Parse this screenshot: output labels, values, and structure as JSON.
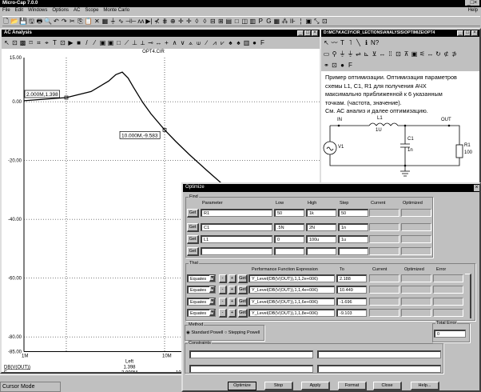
{
  "app": {
    "title": "Micro-Cap 7.0.0",
    "menu": [
      "File",
      "Edit",
      "Windows",
      "Options",
      "AC",
      "Scope",
      "Monte Carlo"
    ],
    "help": "Help",
    "toolbar": [
      "🗋",
      "📂",
      "💾",
      "🖫",
      "🖶",
      "🔍",
      "↶",
      "↷",
      "✂",
      "⎘",
      "📋",
      "✕",
      "▦",
      "⏚",
      "∿",
      "⊣⊢",
      "ᴧᴧ",
      "▶|",
      "⊀",
      "⋕",
      "⊕",
      "✛",
      "✛",
      "◊",
      "◊",
      "⊟",
      "⊞",
      "▤",
      "□",
      "◫",
      "▥",
      "P",
      "G",
      "▦",
      "⁂",
      "⊪",
      "¦",
      "▣",
      "⤡",
      "⊡"
    ],
    "window_controls": [
      "_",
      "□",
      "×"
    ]
  },
  "ac_window": {
    "title": "AC Analysis",
    "toolbar": [
      "↖",
      "⊡",
      "▩",
      "⌑",
      "⌗",
      "⌖",
      "T",
      "⊡",
      "▶",
      "■",
      "/",
      "⁄",
      "▣",
      "▣",
      "□",
      "⟋",
      "⊥",
      "⟂",
      "⊸",
      "↔",
      "+",
      "∧",
      "∨",
      "⟑",
      "⟒",
      "∕",
      "⩘",
      "⩗",
      "♠",
      "♠",
      "▥",
      "●",
      "F"
    ],
    "status": "Cursor Mode"
  },
  "chart_data": {
    "type": "line",
    "title": "OPT4.CIR",
    "xscale": "log",
    "xlim": [
      1,
      100
    ],
    "ylim": [
      -85,
      15
    ],
    "x_ticks": [
      {
        "v": 1,
        "label": "1M"
      },
      {
        "v": 10,
        "label": "10M"
      }
    ],
    "y_ticks": [
      {
        "v": 15,
        "label": "15.00"
      },
      {
        "v": 0,
        "label": "0.00"
      },
      {
        "v": -20,
        "label": "-20.00"
      },
      {
        "v": -40,
        "label": "-40.00"
      },
      {
        "v": -60,
        "label": "-60.00"
      },
      {
        "v": -80,
        "label": "-80.00"
      },
      {
        "v": -85,
        "label": "-85.00"
      }
    ],
    "grid": true,
    "line_color": "#000000",
    "x": [
      1,
      2,
      3,
      4,
      4.5,
      5,
      5.5,
      6,
      7,
      8,
      10,
      12,
      15,
      20,
      30,
      40
    ],
    "y": [
      0.33,
      1.398,
      3.46,
      7.01,
      9.2,
      10.05,
      8.04,
      4.96,
      -0.28,
      -4.12,
      -9.583,
      -13.5,
      -18.0,
      -23.4,
      -30.8,
      -35.9
    ],
    "cursors": [
      {
        "x": 2,
        "y": 1.398,
        "label": "2.000M,1.398"
      },
      {
        "x": 10,
        "y": -9.583,
        "label": "10.000M,-9.583"
      }
    ],
    "readout": {
      "header": "Left",
      "expr": "DB(V(OUT))",
      "expr_value": "1.398",
      "xvar": "F",
      "xvar_value": "2.000M",
      "right_partial": "10"
    }
  },
  "circuit_window": {
    "title": "D:\\MC7\\KAC3Y\\CIR_LECTIONS\\ANALYSIS\\OPTIMIZE\\OPT4",
    "toolbar1": [
      "↖",
      "〰",
      "T",
      "˥",
      "╲",
      "ℹ",
      "N?"
    ],
    "toolbar2": [
      "▭",
      "⚲",
      "⏚",
      "⏚",
      "⇌",
      "⊾",
      "⊻",
      "↔",
      "⁞⁞",
      "⊡",
      "⊼",
      "▣",
      "⚟",
      "↔",
      "↻",
      "⊄",
      "⊅"
    ],
    "toolbar3": [
      "⚭",
      "⊡",
      "●",
      "F"
    ],
    "text": [
      "Пример оптимизации. Оптимизация параметров",
      "схемы L1, C1, R1 для получения АЧХ",
      "максимально приближенной к 6 указанным",
      "точкам. (частота, значение).",
      "См. АС анализ и далее  оптимизацию."
    ],
    "labels": {
      "in": "IN",
      "out": "OUT",
      "l1": "L1",
      "l1v": "1U",
      "c1": "C1",
      "c1v": "1n",
      "r1": "R1",
      "r1v": "100",
      "v1": "V1"
    }
  },
  "optimize": {
    "title": "Optimize",
    "close": "×",
    "find": {
      "legend": "Find",
      "headers": [
        "Parameter",
        "Low",
        "High",
        "Step",
        "Current",
        "Optimized"
      ],
      "get_label": "Get",
      "rows": [
        {
          "param": "R1",
          "low": "50",
          "high": "1k",
          "step": "50"
        },
        {
          "param": "C1",
          "low": ".5N",
          "high": "2N",
          "step": "1n"
        },
        {
          "param": "L1",
          "low": "0",
          "high": "100u",
          "step": "1u"
        },
        {
          "param": "",
          "low": "",
          "high": "",
          "step": ""
        }
      ]
    },
    "that": {
      "legend": "That",
      "headers": [
        "Performance Function Expression",
        "To",
        "Current",
        "Optimized",
        "Error"
      ],
      "minus": "-",
      "plus": "+",
      "get_label": "Get",
      "rows": [
        {
          "mode": "Equates",
          "expr": "Y_Level(DB(V(OUT)),1,1,2e+006)",
          "to": "2.188"
        },
        {
          "mode": "Equates",
          "expr": "Y_Level(DB(V(OUT)),1,1,4e+006)",
          "to": "10.449"
        },
        {
          "mode": "Equates",
          "expr": "Y_Level(DB(V(OUT)),1,1,6e+006)",
          "to": "-1.696"
        },
        {
          "mode": "Equates",
          "expr": "Y_Level(DB(V(OUT)),1,1,8e+006)",
          "to": "-9.103"
        }
      ]
    },
    "method": {
      "legend": "Method",
      "options": [
        "Standard Powell",
        "Stepping Powell"
      ],
      "selected": 0
    },
    "total_error": {
      "legend": "Total Error",
      "value": "0"
    },
    "constraints": {
      "legend": "Constraints"
    },
    "buttons": [
      "Optimize",
      "Stop",
      "Apply",
      "Format",
      "Close",
      "Help..."
    ]
  }
}
